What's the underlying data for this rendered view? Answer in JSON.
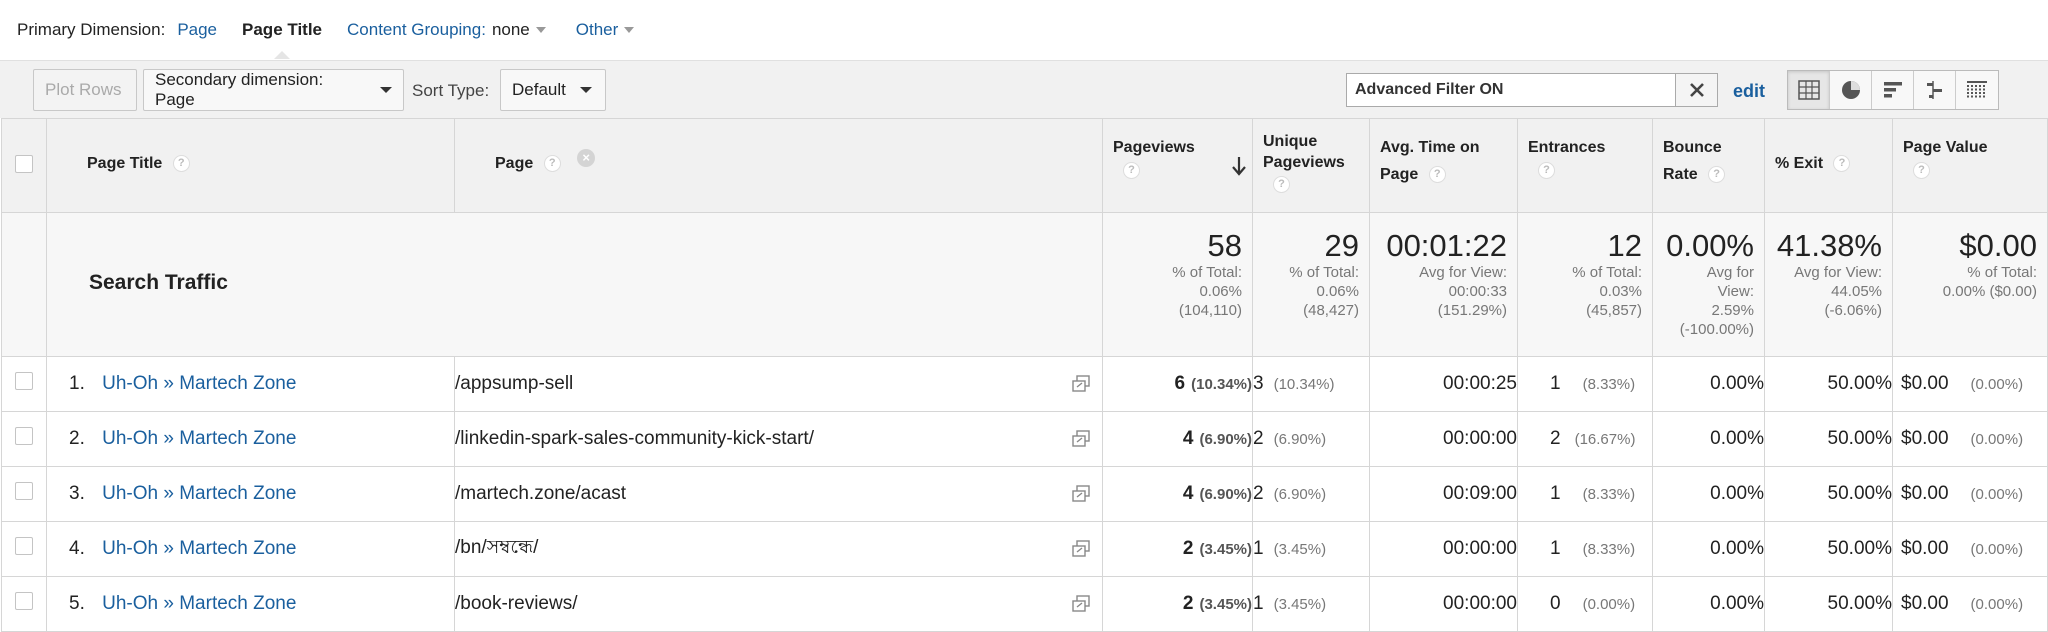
{
  "primary_dimension": {
    "label": "Primary Dimension:",
    "options": [
      {
        "label": "Page",
        "active": false
      },
      {
        "label": "Page Title",
        "active": true
      }
    ],
    "content_grouping_label": "Content Grouping:",
    "content_grouping_value": "none",
    "other_label": "Other"
  },
  "toolbar": {
    "plot_rows_label": "Plot Rows",
    "secondary_dimension_label": "Secondary dimension: Page",
    "sort_type_label": "Sort Type:",
    "sort_type_value": "Default",
    "filter_value": "Advanced Filter ON",
    "edit_label": "edit",
    "view_icons": [
      "table-view-icon",
      "pie-view-icon",
      "bar-view-icon",
      "comparison-view-icon",
      "pivot-view-icon"
    ]
  },
  "table": {
    "headers": {
      "page_title": "Page Title",
      "page": "Page",
      "pageviews": "Pageviews",
      "unique_pageviews_1": "Unique",
      "unique_pageviews_2": "Pageviews",
      "avg_time_1": "Avg. Time on",
      "avg_time_2": "Page",
      "entrances": "Entrances",
      "bounce_rate_1": "Bounce",
      "bounce_rate_2": "Rate",
      "pct_exit": "% Exit",
      "page_value": "Page Value"
    },
    "summary": {
      "title": "Search Traffic",
      "pageviews": {
        "big": "58",
        "l1": "% of Total:",
        "l2": "0.06%",
        "l3": "(104,110)"
      },
      "unique_pageviews": {
        "big": "29",
        "l1": "% of Total:",
        "l2": "0.06%",
        "l3": "(48,427)"
      },
      "avg_time": {
        "big": "00:01:22",
        "l1": "Avg for View:",
        "l2": "00:00:33",
        "l3": "(151.29%)"
      },
      "entrances": {
        "big": "12",
        "l1": "% of Total:",
        "l2": "0.03%",
        "l3": "(45,857)"
      },
      "bounce_rate": {
        "big": "0.00%",
        "l1": "Avg for",
        "l2": "View:",
        "l3": "2.59%",
        "l4": "(-100.00%)"
      },
      "pct_exit": {
        "big": "41.38%",
        "l1": "Avg for View:",
        "l2": "44.05%",
        "l3": "(-6.06%)"
      },
      "page_value": {
        "big": "$0.00",
        "l1": "% of Total:",
        "l2": "0.00% ($0.00)"
      }
    },
    "rows": [
      {
        "idx": "1.",
        "title": "Uh-Oh » Martech Zone",
        "page": "/appsump-sell",
        "pv": "6",
        "pv_pct": "(10.34%)",
        "upv": "3",
        "upv_pct": "(10.34%)",
        "avg_time": "00:00:25",
        "ent": "1",
        "ent_pct": "(8.33%)",
        "bounce": "0.00%",
        "exit": "50.00%",
        "value": "$0.00",
        "value_pct": "(0.00%)"
      },
      {
        "idx": "2.",
        "title": "Uh-Oh » Martech Zone",
        "page": "/linkedin-spark-sales-community-kick-start/",
        "pv": "4",
        "pv_pct": "(6.90%)",
        "upv": "2",
        "upv_pct": "(6.90%)",
        "avg_time": "00:00:00",
        "ent": "2",
        "ent_pct": "(16.67%)",
        "bounce": "0.00%",
        "exit": "50.00%",
        "value": "$0.00",
        "value_pct": "(0.00%)"
      },
      {
        "idx": "3.",
        "title": "Uh-Oh » Martech Zone",
        "page": "/martech.zone/acast",
        "pv": "4",
        "pv_pct": "(6.90%)",
        "upv": "2",
        "upv_pct": "(6.90%)",
        "avg_time": "00:09:00",
        "ent": "1",
        "ent_pct": "(8.33%)",
        "bounce": "0.00%",
        "exit": "50.00%",
        "value": "$0.00",
        "value_pct": "(0.00%)"
      },
      {
        "idx": "4.",
        "title": "Uh-Oh » Martech Zone",
        "page": "/bn/সম্বন্ধে/",
        "pv": "2",
        "pv_pct": "(3.45%)",
        "upv": "1",
        "upv_pct": "(3.45%)",
        "avg_time": "00:00:00",
        "ent": "1",
        "ent_pct": "(8.33%)",
        "bounce": "0.00%",
        "exit": "50.00%",
        "value": "$0.00",
        "value_pct": "(0.00%)"
      },
      {
        "idx": "5.",
        "title": "Uh-Oh » Martech Zone",
        "page": "/book-reviews/",
        "pv": "2",
        "pv_pct": "(3.45%)",
        "upv": "1",
        "upv_pct": "(3.45%)",
        "avg_time": "00:00:00",
        "ent": "0",
        "ent_pct": "(0.00%)",
        "bounce": "0.00%",
        "exit": "50.00%",
        "value": "$0.00",
        "value_pct": "(0.00%)"
      }
    ]
  },
  "colors": {
    "link": "#1a5f9e",
    "header_bg": "#f1f1f1",
    "summary_bg": "#f7f7f7"
  }
}
